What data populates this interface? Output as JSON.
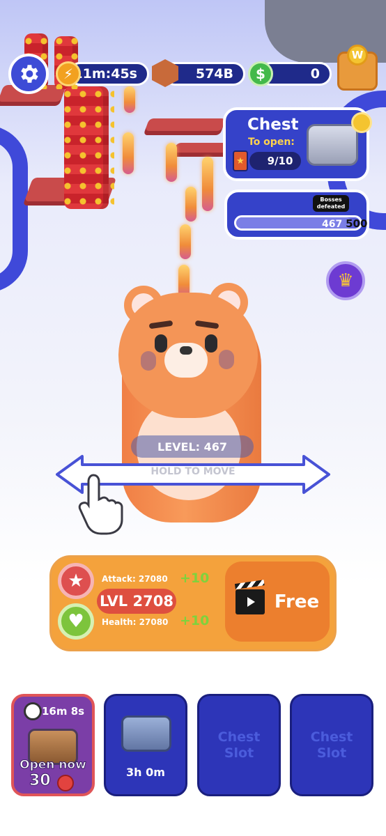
{
  "top_bar": {
    "timer": "11m:45s",
    "gems": "574B",
    "cash": "0",
    "wallet_coin": "W"
  },
  "chest_panel": {
    "title": "Chest",
    "subtitle": "To open:",
    "progress": "9/10",
    "progress_fraction": 0.9
  },
  "boss_panel": {
    "label": "Bosses defeated",
    "current": "467",
    "target": "500",
    "progress_fraction": 0.934
  },
  "player": {
    "level_label": "LEVEL: 467",
    "hint": "HOLD TO MOVE"
  },
  "upgrade": {
    "attack_label": "Attack: 27080",
    "attack_bonus": "+10",
    "health_label": "Health: 27080",
    "health_bonus": "+10",
    "level": "LVL 2708",
    "free_label": "Free"
  },
  "slots": [
    {
      "timer": "16m 8s",
      "action": "Open now",
      "cost": "30"
    },
    {
      "timer": "3h 0m"
    },
    {
      "label": "Chest Slot"
    },
    {
      "label": "Chest Slot"
    }
  ],
  "colors": {
    "primary_blue": "#3542c9",
    "dark_blue": "#1f2a8a",
    "orange": "#f4a23c",
    "red": "#de4f3f",
    "green": "#7fd23c",
    "gold": "#f4c430"
  }
}
